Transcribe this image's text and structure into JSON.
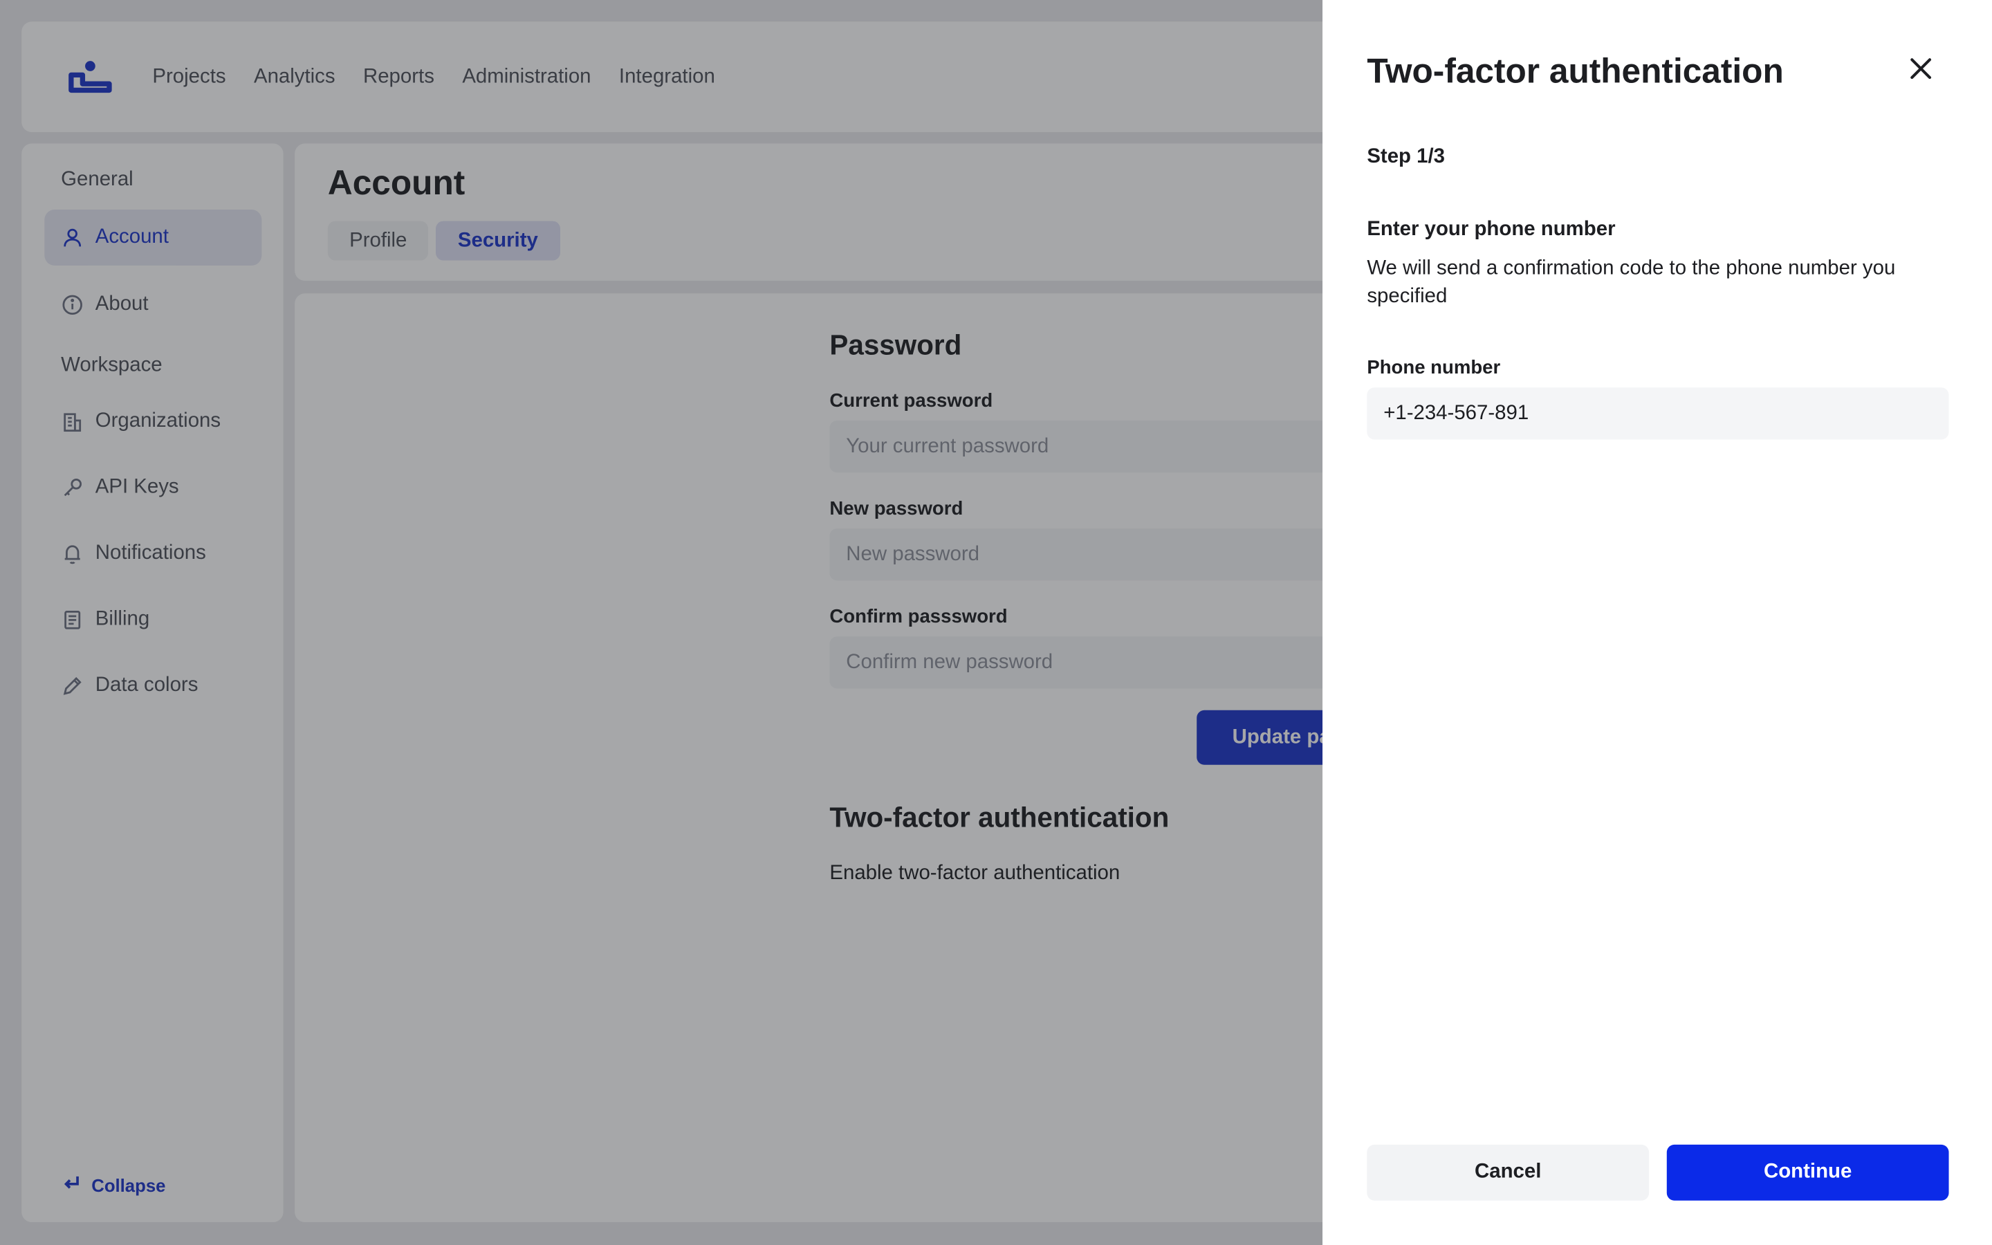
{
  "topnav": {
    "items": [
      "Projects",
      "Analytics",
      "Reports",
      "Administration",
      "Integration"
    ]
  },
  "sidebar": {
    "general_heading": "General",
    "workspace_heading": "Workspace",
    "items": [
      {
        "label": "Account",
        "icon": "user-icon",
        "active": true
      },
      {
        "label": "About",
        "icon": "info-icon"
      },
      {
        "label": "Organizations",
        "icon": "building-icon"
      },
      {
        "label": "API Keys",
        "icon": "key-icon"
      },
      {
        "label": "Notifications",
        "icon": "bell-icon"
      },
      {
        "label": "Billing",
        "icon": "document-icon"
      },
      {
        "label": "Data colors",
        "icon": "pen-icon"
      }
    ],
    "collapse_label": "Collapse"
  },
  "header": {
    "title": "Account",
    "tabs": [
      {
        "label": "Profile",
        "active": false
      },
      {
        "label": "Security",
        "active": true
      }
    ]
  },
  "password_section": {
    "title": "Password",
    "current_label": "Current password",
    "current_placeholder": "Your current password",
    "new_label": "New password",
    "new_placeholder": "New password",
    "confirm_label": "Confirm passsword",
    "confirm_placeholder": "Confirm new password",
    "update_button": "Update pa"
  },
  "twofa_section": {
    "title": "Two-factor authentication",
    "enable_label": "Enable two-factor authentication"
  },
  "drawer": {
    "title": "Two-factor authentication",
    "step": "Step 1/3",
    "heading": "Enter your phone number",
    "description": "We will send a confirmation code to the phone number you specified",
    "phone_label": "Phone number",
    "phone_value": "+1-234-567-891",
    "cancel_label": "Cancel",
    "continue_label": "Continue"
  },
  "colors": {
    "accent": "#1b34c8",
    "primary_button": "#0b2ae8",
    "overlay": "rgba(32,34,40,0.40)"
  }
}
